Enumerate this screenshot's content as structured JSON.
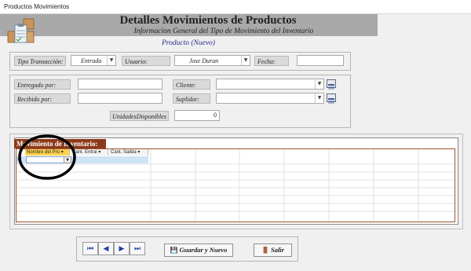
{
  "window": {
    "title": "Productos Movimientos"
  },
  "header": {
    "title": "Detalles Movimientos de Productos",
    "subtitle": "Informacion General del Tipo de Movimiento del Inventario",
    "mode": "Producto  (Nuevo)"
  },
  "form": {
    "tipo_label": "Tipo Transacción:",
    "tipo_value": "Entrada",
    "usuario_label": "Usuario:",
    "usuario_value": "Jose Duran",
    "fecha_label": "Fecha:",
    "fecha_value": "",
    "entregado_label": "Entregado por:",
    "entregado_value": "",
    "recibido_label": "Recibido por:",
    "recibido_value": "",
    "cliente_label": "Cliente:",
    "cliente_value": "",
    "suplidor_label": "Suplidor:",
    "suplidor_value": "",
    "unidades_label": "UnidadesDisponibles",
    "unidades_value": "0"
  },
  "grid": {
    "title": "Movimiento de Inventario:",
    "columns": [
      "Nombre del Pro",
      "Cant. Entrai",
      "Cant. Salida"
    ]
  },
  "nav": {
    "first": "⏮",
    "prev": "◀",
    "next": "▶",
    "last": "⏭"
  },
  "buttons": {
    "guardar": "Guardar y Nuevo",
    "salir": "Salir"
  },
  "colors": {
    "accent": "#8b3a1a",
    "header_band": "#a9a9a9",
    "nav_icon": "#1a3fa8"
  }
}
